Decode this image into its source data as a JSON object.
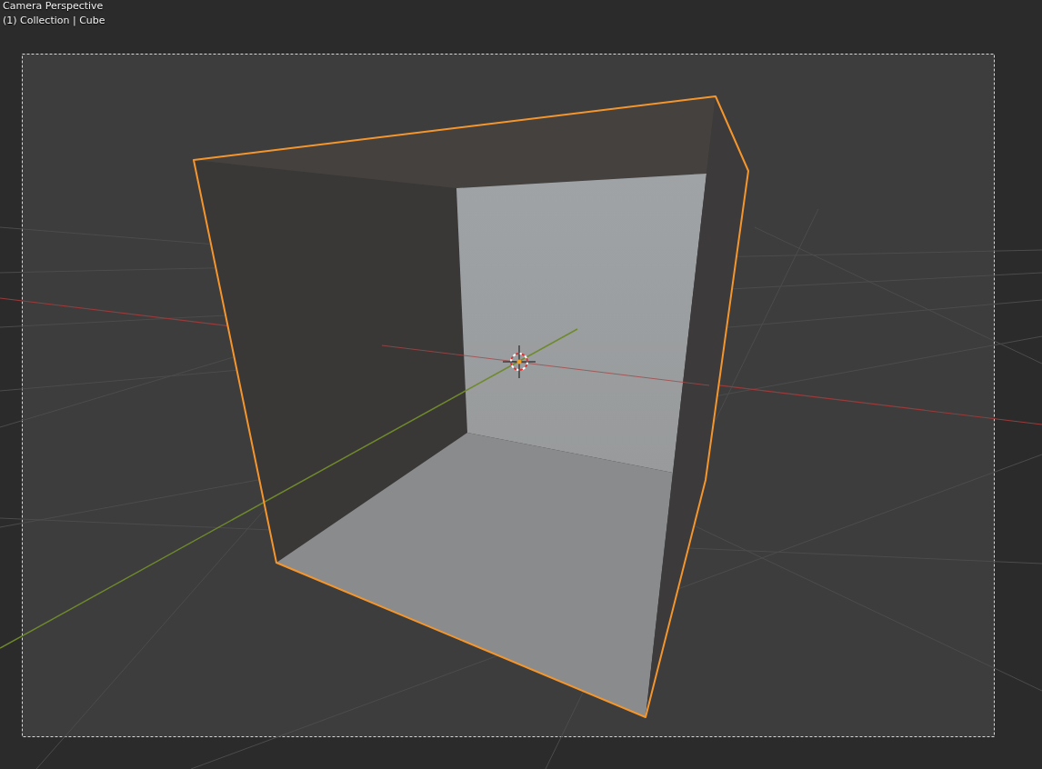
{
  "viewport": {
    "view_name": "Camera Perspective",
    "info": "(1) Collection | Cube"
  }
}
